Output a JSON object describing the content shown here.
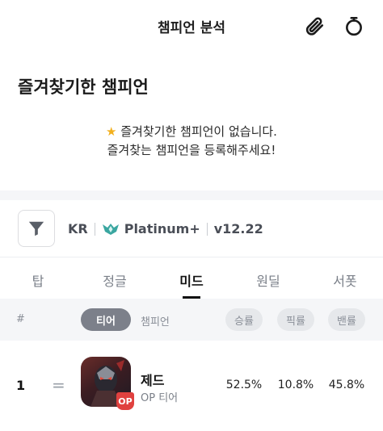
{
  "header": {
    "title": "챔피언 분석",
    "icons": [
      "paperclip-icon",
      "stopwatch-icon"
    ]
  },
  "favorites": {
    "title": "즐겨찾기한 챔피언",
    "empty_line1": "즐겨찾기한 챔피언이 없습니다.",
    "empty_line2": "즐겨찾는 챔피언을 등록해주세요!"
  },
  "filter": {
    "region": "KR",
    "tier": "Platinum+",
    "version": "v12.22"
  },
  "tabs": [
    {
      "label": "탑"
    },
    {
      "label": "정글"
    },
    {
      "label": "미드",
      "active": true
    },
    {
      "label": "원딜"
    },
    {
      "label": "서폿"
    }
  ],
  "columns": {
    "rank": "#",
    "tier": "티어",
    "champion": "챔피언",
    "winrate": "승률",
    "pickrate": "픽률",
    "banrate": "밴률"
  },
  "rows": [
    {
      "rank": "1",
      "change": "=",
      "name": "제드",
      "tier_label": "OP 티어",
      "badge": "OP",
      "winrate": "52.5%",
      "pickrate": "10.8%",
      "banrate": "45.8%"
    }
  ],
  "colors": {
    "accent_dark": "#111111",
    "op_badge": "#e0413f",
    "pill_active": "#7c808a",
    "section_bg": "#f5f6f8",
    "star": "#f2b01e"
  }
}
